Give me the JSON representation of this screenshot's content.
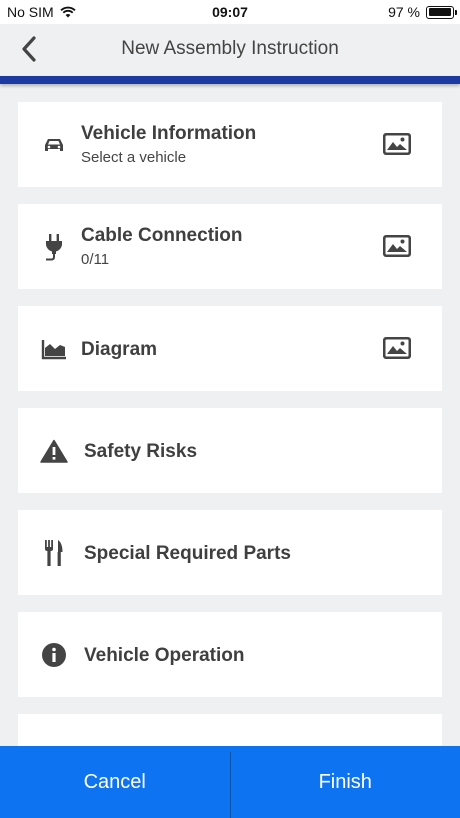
{
  "status_bar": {
    "carrier": "No SIM",
    "time": "09:07",
    "battery": "97 %",
    "battery_level": 0.97
  },
  "header": {
    "title": "New Assembly Instruction",
    "back_icon": "chevron-left-icon"
  },
  "colors": {
    "accent_bar": "#1c3aa1",
    "bottom_bar": "#0d73f0",
    "background": "#eef0f2",
    "card": "#ffffff"
  },
  "items": [
    {
      "title": "Vehicle Information",
      "subtitle": "Select a vehicle",
      "icon": "car-icon",
      "has_image": true
    },
    {
      "title": "Cable Connection",
      "subtitle": "0/11",
      "icon": "plug-icon",
      "has_image": true
    },
    {
      "title": "Diagram",
      "icon": "area-chart-icon",
      "has_image": true
    },
    {
      "title": "Safety Risks",
      "icon": "warning-icon",
      "has_image": false
    },
    {
      "title": "Special Required Parts",
      "icon": "tools-icon",
      "has_image": false
    },
    {
      "title": "Vehicle Operation",
      "icon": "info-icon",
      "has_image": false
    }
  ],
  "footer": {
    "cancel_label": "Cancel",
    "finish_label": "Finish"
  }
}
